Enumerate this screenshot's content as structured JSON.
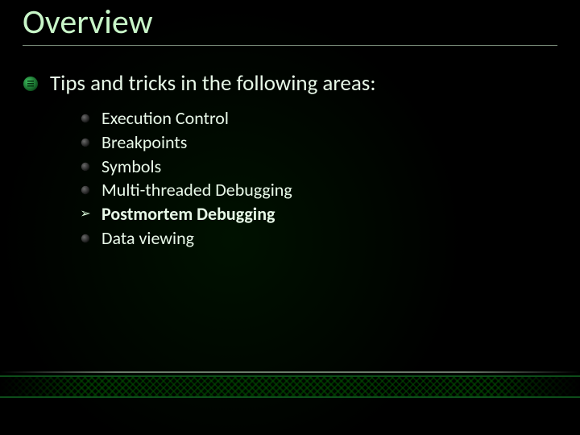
{
  "title": "Overview",
  "lead": "Tips and tricks in the following areas:",
  "items": [
    {
      "label": "Execution Control",
      "marker": "dot",
      "emph": false
    },
    {
      "label": "Breakpoints",
      "marker": "dot",
      "emph": false
    },
    {
      "label": "Symbols",
      "marker": "dot",
      "emph": false
    },
    {
      "label": "Multi-threaded Debugging",
      "marker": "dot",
      "emph": false
    },
    {
      "label": "Postmortem Debugging",
      "marker": "arrow",
      "emph": true
    },
    {
      "label": "Data viewing",
      "marker": "dot",
      "emph": false
    }
  ],
  "colors": {
    "accent": "#1f8a3b",
    "text": "#e8f8e8"
  }
}
